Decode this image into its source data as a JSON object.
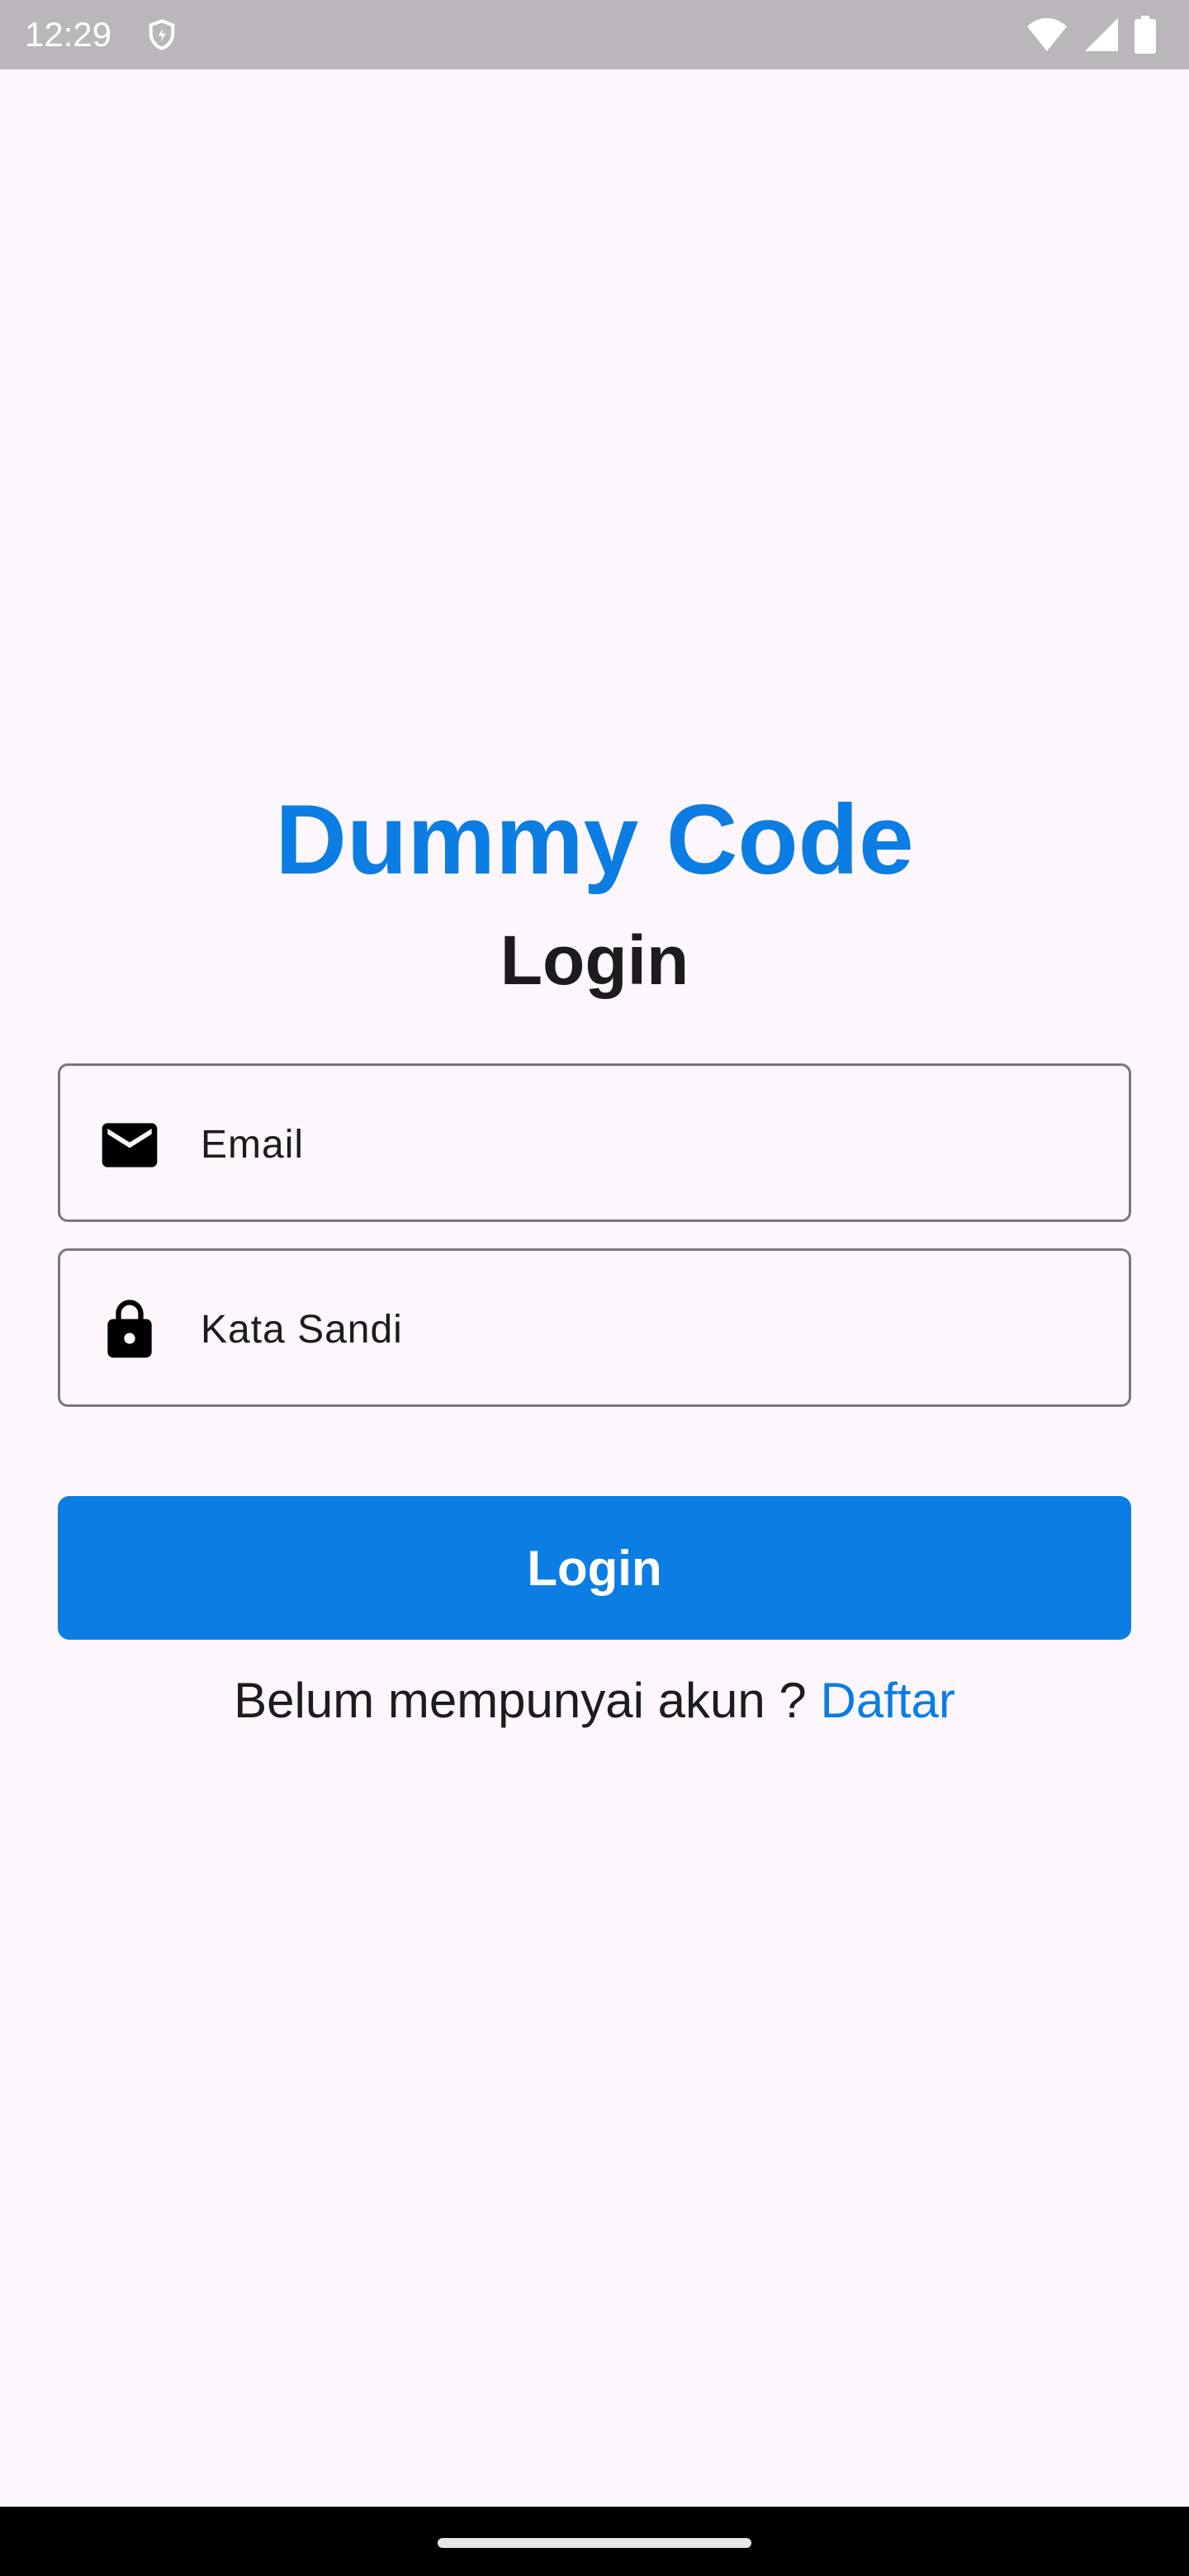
{
  "status_bar": {
    "time": "12:29",
    "icons": [
      "shield-icon",
      "wifi-icon",
      "cellular-signal-icon",
      "battery-icon"
    ]
  },
  "app": {
    "title": "Dummy Code",
    "subtitle": "Login"
  },
  "form": {
    "email": {
      "placeholder": "Email",
      "value": "",
      "icon": "mail-icon"
    },
    "password": {
      "placeholder": "Kata Sandi",
      "value": "",
      "icon": "lock-icon"
    },
    "login_button_label": "Login"
  },
  "register": {
    "prompt": "Belum mempunyai akun ? ",
    "link_label": "Daftar"
  },
  "colors": {
    "accent": "#0b7de3",
    "background": "#fdf7fd",
    "status_bar": "#bab6bc",
    "text": "#1d1b20",
    "outline": "#79747e"
  }
}
